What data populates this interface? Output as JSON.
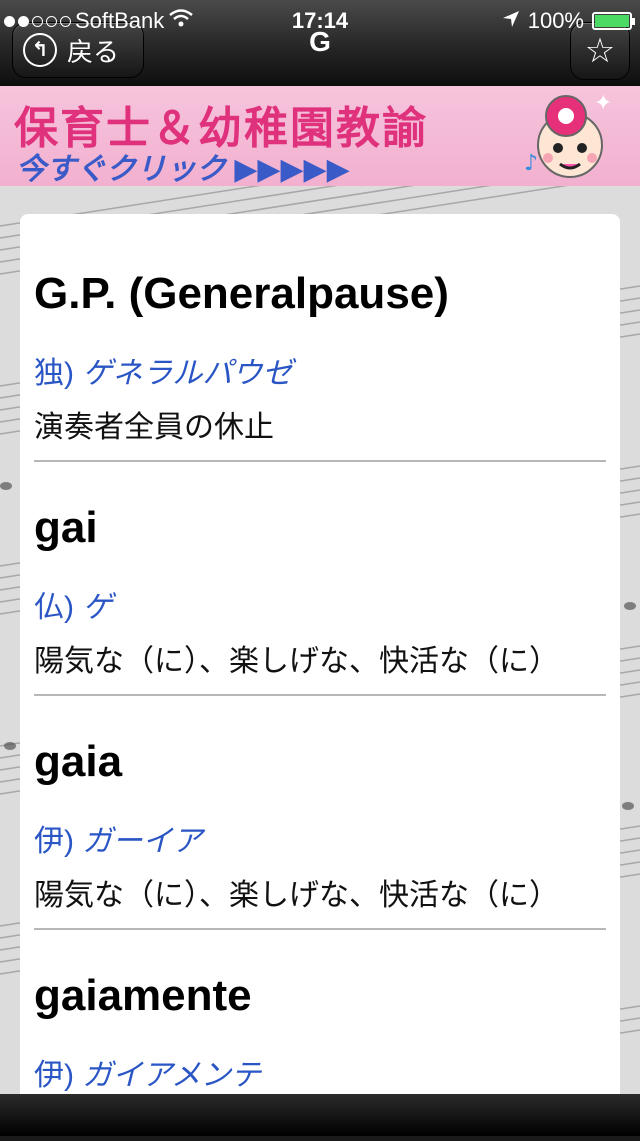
{
  "status_bar": {
    "carrier": "SoftBank",
    "time": "17:14",
    "battery": "100%",
    "battery_level": 1.0,
    "signal_bars": 2,
    "signal_total": 5
  },
  "nav": {
    "back_label": "戻る",
    "title": "G",
    "star_symbol": "☆"
  },
  "ad": {
    "line1": "保育士＆幼稚園教諭",
    "line2": "今すぐクリック ▶▶▶▶▶"
  },
  "entries": [
    {
      "term": "G.P. (Generalpause)",
      "lang": "独)",
      "reading": "ゲネラルパウゼ",
      "meaning": "演奏者全員の休止"
    },
    {
      "term": "gai",
      "lang": "仏)",
      "reading": "ゲ",
      "meaning": "陽気な（に）、楽しげな、快活な（に）"
    },
    {
      "term": "gaia",
      "lang": "伊)",
      "reading": "ガーイア",
      "meaning": "陽気な（に）、楽しげな、快活な（に）"
    },
    {
      "term": "gaiamente",
      "lang": "伊)",
      "reading": "ガイアメンテ",
      "meaning": ""
    }
  ],
  "colors": {
    "reading_blue": "#2a55c4",
    "ad_pink": "#e0317d",
    "ad_blue": "#3a5bc7",
    "battery_green": "#4cd964"
  }
}
